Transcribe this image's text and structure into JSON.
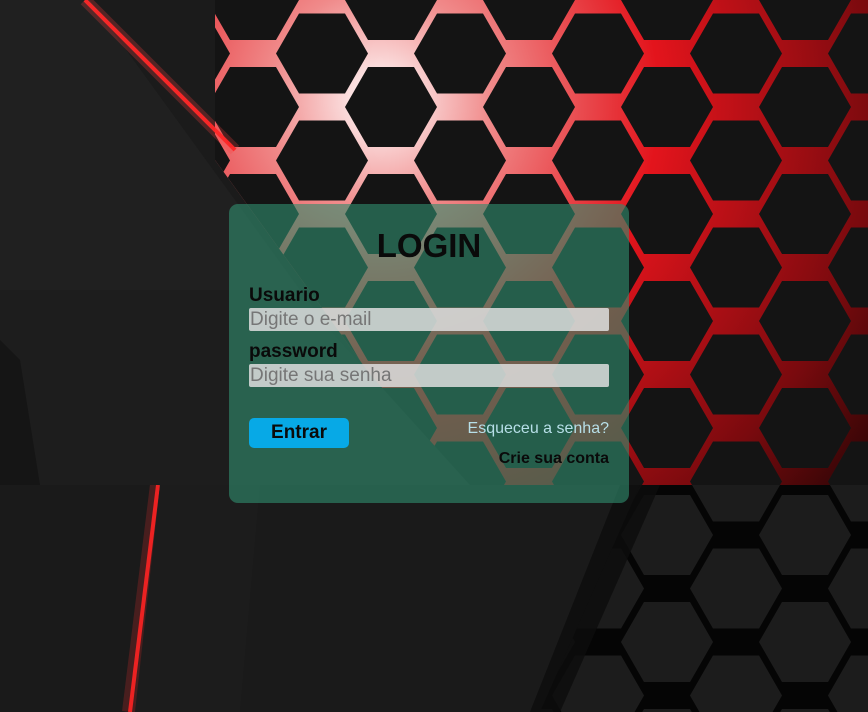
{
  "login": {
    "title": "LOGIN",
    "username_label": "Usuario",
    "username_placeholder": "Digite o e-mail",
    "username_value": "",
    "password_label": "password",
    "password_placeholder": "Digite sua senha",
    "password_value": "",
    "submit_label": "Entrar",
    "forgot_link": "Esqueceu a senha?",
    "create_account_link": "Crie sua conta"
  },
  "colors": {
    "card_background": "#308c6e",
    "submit_button": "#07a9e6",
    "forgot_link": "#b7dfe8",
    "background_dark": "#1b1b1b",
    "background_accent": "#e3141c"
  }
}
